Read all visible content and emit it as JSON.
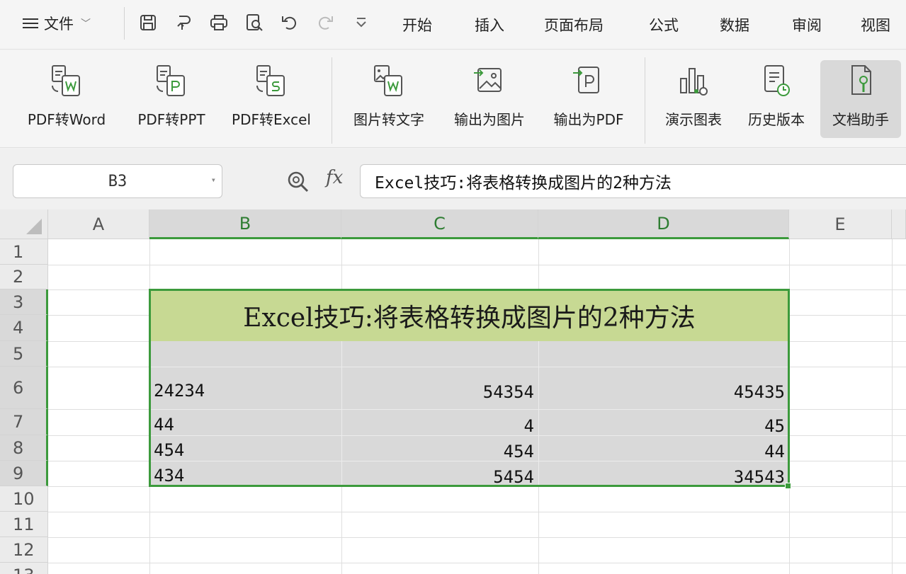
{
  "menubar": {
    "file_label": "文件",
    "quick_access": [
      "save-icon",
      "export-icon",
      "print-icon",
      "preview-icon",
      "undo-icon",
      "redo-icon",
      "more-icon"
    ],
    "tabs": [
      "开始",
      "插入",
      "页面布局",
      "公式",
      "数据",
      "审阅",
      "视图"
    ]
  },
  "ribbon": {
    "tools": [
      {
        "label": "PDF转Word",
        "icon": "pdf-to-word-icon"
      },
      {
        "label": "PDF转PPT",
        "icon": "pdf-to-ppt-icon"
      },
      {
        "label": "PDF转Excel",
        "icon": "pdf-to-excel-icon"
      },
      {
        "label": "图片转文字",
        "icon": "image-to-text-icon"
      },
      {
        "label": "输出为图片",
        "icon": "export-image-icon"
      },
      {
        "label": "输出为PDF",
        "icon": "export-pdf-icon"
      },
      {
        "label": "演示图表",
        "icon": "demo-chart-icon"
      },
      {
        "label": "历史版本",
        "icon": "history-icon"
      },
      {
        "label": "文档助手",
        "icon": "doc-assistant-icon",
        "active": true
      }
    ]
  },
  "formula_bar": {
    "name_box": "B3",
    "fx_label": "fx",
    "formula": "Excel技巧:将表格转换成图片的2种方法"
  },
  "sheet": {
    "columns": [
      "A",
      "B",
      "C",
      "D",
      "E"
    ],
    "rows": [
      "1",
      "2",
      "3",
      "4",
      "5",
      "6",
      "7",
      "8",
      "9",
      "10",
      "11",
      "12",
      "13"
    ],
    "title": "Excel技巧:将表格转换成图片的2种方法",
    "data": [
      [
        "24234",
        "54354",
        "45435"
      ],
      [
        "44",
        "4",
        "45"
      ],
      [
        "454",
        "454",
        "44"
      ],
      [
        "434",
        "5454",
        "34543"
      ]
    ]
  },
  "colors": {
    "accent_green": "#3c9a3c",
    "title_fill": "#c7d993",
    "selection_fill": "#d9d9d9"
  }
}
